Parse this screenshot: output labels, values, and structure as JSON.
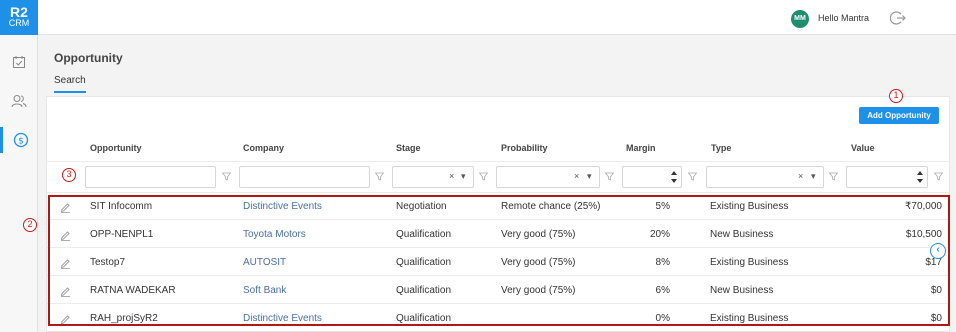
{
  "logo": {
    "line1": "R2",
    "line2": "CRM"
  },
  "sidebar": {
    "items": [
      {
        "icon": "task-icon"
      },
      {
        "icon": "contacts-icon"
      },
      {
        "icon": "dollar-icon",
        "active": true
      }
    ]
  },
  "topbar": {
    "avatar_initials": "MM",
    "greeting": "Hello Mantra",
    "logout_icon": "logout-icon"
  },
  "page": {
    "title": "Opportunity",
    "tab": "Search"
  },
  "toolbar": {
    "add_label": "Add Opportunity"
  },
  "columns": [
    "Opportunity",
    "Company",
    "Stage",
    "Probability",
    "Margin",
    "Type",
    "Value"
  ],
  "filters": {
    "clear_glyph": "×",
    "dropdown_glyph": "▾"
  },
  "rows": [
    {
      "opportunity": "SIT Infocomm",
      "company": "Distinctive Events",
      "stage": "Negotiation",
      "probability": "Remote chance (25%)",
      "margin": "5%",
      "type": "Existing Business",
      "value": "₹70,000"
    },
    {
      "opportunity": "OPP-NENPL1",
      "company": "Toyota Motors",
      "stage": "Qualification",
      "probability": "Very good (75%)",
      "margin": "20%",
      "type": "New Business",
      "value": "$10,500"
    },
    {
      "opportunity": "Testop7",
      "company": "AUTOSIT",
      "stage": "Qualification",
      "probability": "Very good (75%)",
      "margin": "8%",
      "type": "Existing Business",
      "value": "$17"
    },
    {
      "opportunity": "RATNA WADEKAR",
      "company": "Soft Bank",
      "stage": "Qualification",
      "probability": "Very good (75%)",
      "margin": "6%",
      "type": "New Business",
      "value": "$0"
    },
    {
      "opportunity": "RAH_projSyR2",
      "company": "Distinctive Events",
      "stage": "Qualification",
      "probability": "",
      "margin": "0%",
      "type": "Existing Business",
      "value": "$0"
    }
  ],
  "annotations": {
    "c1": "1",
    "c2": "2",
    "c3": "3"
  },
  "colors": {
    "accent": "#1e90e8",
    "annotation": "#c81a1a",
    "avatar": "#1f8e6e",
    "link": "#4a6fa5"
  }
}
